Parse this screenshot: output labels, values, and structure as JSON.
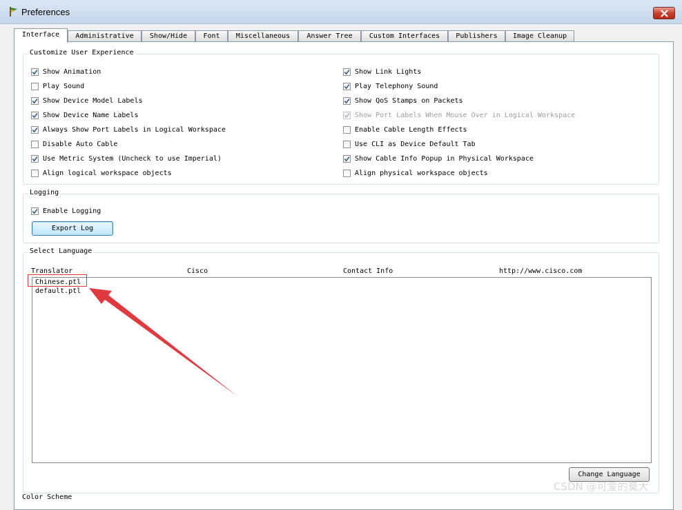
{
  "window": {
    "title": "Preferences",
    "icon": "packet-tracer-icon",
    "close_icon": "close-icon"
  },
  "tabs": [
    {
      "label": "Interface",
      "active": true
    },
    {
      "label": "Administrative"
    },
    {
      "label": "Show/Hide"
    },
    {
      "label": "Font"
    },
    {
      "label": "Miscellaneous"
    },
    {
      "label": "Answer Tree"
    },
    {
      "label": "Custom Interfaces"
    },
    {
      "label": "Publishers"
    },
    {
      "label": "Image Cleanup"
    }
  ],
  "customize": {
    "title": "Customize User Experience",
    "left": [
      {
        "label": "Show Animation",
        "checked": true
      },
      {
        "label": "Play Sound",
        "checked": false
      },
      {
        "label": "Show Device Model Labels",
        "checked": true
      },
      {
        "label": "Show Device Name Labels",
        "checked": true
      },
      {
        "label": "Always Show Port Labels in Logical Workspace",
        "checked": true
      },
      {
        "label": "Disable Auto Cable",
        "checked": false
      },
      {
        "label": "Use Metric System (Uncheck to use Imperial)",
        "checked": true
      },
      {
        "label": "Align logical workspace objects",
        "checked": false
      }
    ],
    "right": [
      {
        "label": "Show Link Lights",
        "checked": true
      },
      {
        "label": "Play Telephony Sound",
        "checked": true
      },
      {
        "label": "Show QoS Stamps on Packets",
        "checked": true
      },
      {
        "label": "Show Port Labels When Mouse Over in Logical Workspace",
        "checked": true,
        "disabled": true
      },
      {
        "label": "Enable Cable Length Effects",
        "checked": false
      },
      {
        "label": "Use CLI as Device Default Tab",
        "checked": false
      },
      {
        "label": "Show Cable Info Popup in Physical Workspace",
        "checked": true
      },
      {
        "label": "Align physical workspace objects",
        "checked": false
      }
    ]
  },
  "logging": {
    "title": "Logging",
    "enable_label": "Enable Logging",
    "enable_checked": true,
    "export_label": "Export Log"
  },
  "language": {
    "title": "Select Language",
    "headers": [
      "Translator",
      "Cisco",
      "Contact Info",
      "http://www.cisco.com"
    ],
    "items": [
      "Chinese.ptl",
      "default.ptl"
    ],
    "change_label": "Change Language"
  },
  "color_scheme": {
    "title": "Color Scheme"
  },
  "watermark": "CSDN @可爱的莫大",
  "colors": {
    "annotation": "#e0393f",
    "titlebar": "#c5d6ea"
  }
}
